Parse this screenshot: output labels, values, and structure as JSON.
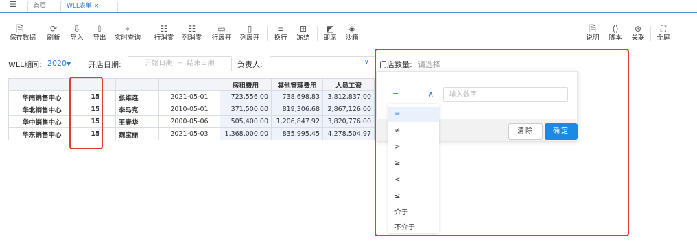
{
  "tabs": {
    "menu_icon": "list-icon",
    "home": "首页",
    "active": "WLL表单",
    "close": "×"
  },
  "toolbar_left": [
    {
      "icon": "save-icon",
      "glyph": "🗎",
      "label": "保存数据"
    },
    {
      "icon": "refresh-icon",
      "glyph": "⟳",
      "label": "刷新"
    },
    {
      "icon": "import-icon",
      "glyph": "⇩",
      "label": "导入"
    },
    {
      "icon": "export-icon",
      "glyph": "⇧",
      "label": "导出"
    },
    {
      "icon": "realtime-query-icon",
      "glyph": "⌖",
      "label": "实时查询"
    },
    {
      "icon": "row-cancel-icon",
      "glyph": "☷",
      "label": "行消零"
    },
    {
      "icon": "col-cancel-icon",
      "glyph": "☷",
      "label": "列消零"
    },
    {
      "icon": "row-expand-icon",
      "glyph": "▭",
      "label": "行展开"
    },
    {
      "icon": "col-expand-icon",
      "glyph": "▯",
      "label": "列展开"
    },
    {
      "icon": "wrap-icon",
      "glyph": "≡",
      "label": "换行"
    },
    {
      "icon": "freeze-icon",
      "glyph": "⊞",
      "label": "冻结"
    },
    {
      "icon": "instant-icon",
      "glyph": "◩",
      "label": "即席"
    },
    {
      "icon": "sandbox-icon",
      "glyph": "◈",
      "label": "沙箱"
    }
  ],
  "toolbar_right": [
    {
      "icon": "doc-icon",
      "glyph": "🗎",
      "label": "说明"
    },
    {
      "icon": "script-icon",
      "glyph": "⟨⟩",
      "label": "脚本"
    },
    {
      "icon": "link-icon",
      "glyph": "⊛",
      "label": "关联"
    },
    {
      "icon": "fullscreen-icon",
      "glyph": "⛶",
      "label": "全屏"
    }
  ],
  "filters": {
    "period_label": "WLL期间:",
    "period_value": "2020",
    "open_date_label": "开店日期:",
    "date_start": "开始日期",
    "date_sep": "~",
    "date_end": "结束日期",
    "owner_label": "负责人:",
    "store_count_label": "门店数量:",
    "store_count_placeholder": "请选择"
  },
  "table": {
    "headers": [
      "",
      "",
      "",
      "",
      "房租费用",
      "其他管理费用",
      "人员工资"
    ],
    "rows": [
      [
        "华南销售中心",
        "15",
        "张维连",
        "2021-05-01",
        "723,556.00",
        "738,698.83",
        "3,812,837.00"
      ],
      [
        "华北销售中心",
        "15",
        "李马克",
        "2010-05-01",
        "371,500.00",
        "819,306.68",
        "2,867,126.00"
      ],
      [
        "华中销售中心",
        "15",
        "王春华",
        "2000-05-06",
        "505,400.00",
        "1,206,847.92",
        "3,820,776.00"
      ],
      [
        "华东销售中心",
        "15",
        "魏宝丽",
        "2021-05-03",
        "1,368,000.00",
        "835,995.45",
        "4,278,504.97"
      ]
    ]
  },
  "filter_popup": {
    "operator": "=",
    "number_placeholder": "输入数字",
    "clear_label": "清除",
    "confirm_label": "确定",
    "options": [
      "=",
      "≠",
      ">",
      "≥",
      "<",
      "≤",
      "介于",
      "不介于"
    ]
  }
}
